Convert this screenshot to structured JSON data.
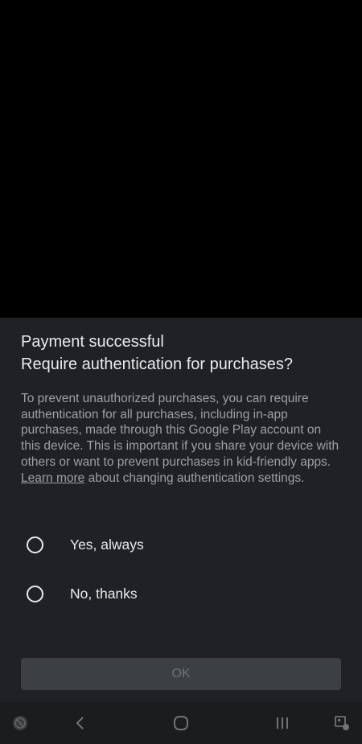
{
  "dialog": {
    "title_line1": "Payment successful",
    "title_line2": "Require authentication for purchases?",
    "body_before_link": "To prevent unauthorized purchases, you can require authentication for all purchases, including in-app purchases, made through this Google Play account on this device. This is important if you share your device with others or want to prevent purchases in kid-friendly apps. ",
    "link_text": "Learn more",
    "body_after_link": " about changing authentication settings.",
    "options": [
      {
        "label": "Yes, always",
        "selected": false
      },
      {
        "label": "No, thanks",
        "selected": false
      }
    ],
    "ok_label": "OK",
    "ok_enabled": false
  },
  "navigation_bar": {
    "icons": [
      "accessibility-icon",
      "back-icon",
      "home-icon",
      "recent-apps-icon",
      "keyboard-switch-icon"
    ]
  },
  "colors": {
    "sheet_background": "#202124",
    "title_text": "#e8eaed",
    "body_text": "#9aa0a6",
    "button_disabled_bg": "#3c4043",
    "button_disabled_text": "#6f7378"
  }
}
